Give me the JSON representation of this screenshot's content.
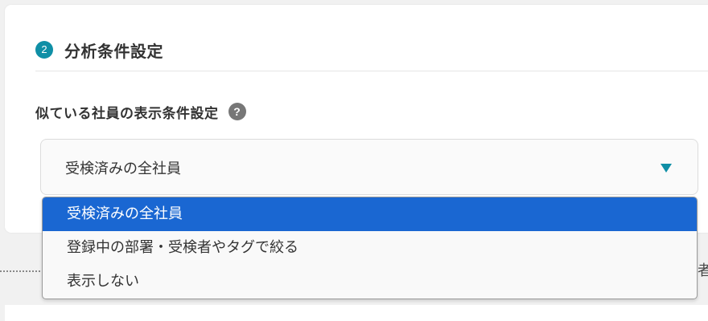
{
  "section": {
    "step_number": "2",
    "title": "分析条件設定"
  },
  "field": {
    "label": "似ている社員の表示条件設定",
    "help_symbol": "?"
  },
  "select": {
    "value": "受検済みの全社員",
    "options": [
      {
        "label": "受検済みの全社員",
        "selected": true
      },
      {
        "label": "登録中の部署・受検者やタグで絞る",
        "selected": false
      },
      {
        "label": "表示しない",
        "selected": false
      }
    ]
  },
  "background_edge_text": "者",
  "colors": {
    "accent": "#0f8fa6",
    "selected_option_bg": "#1a67d2",
    "help_icon_bg": "#777777"
  },
  "icons": {
    "help": "question-circle-icon",
    "dropdown": "triangle-down-icon"
  }
}
